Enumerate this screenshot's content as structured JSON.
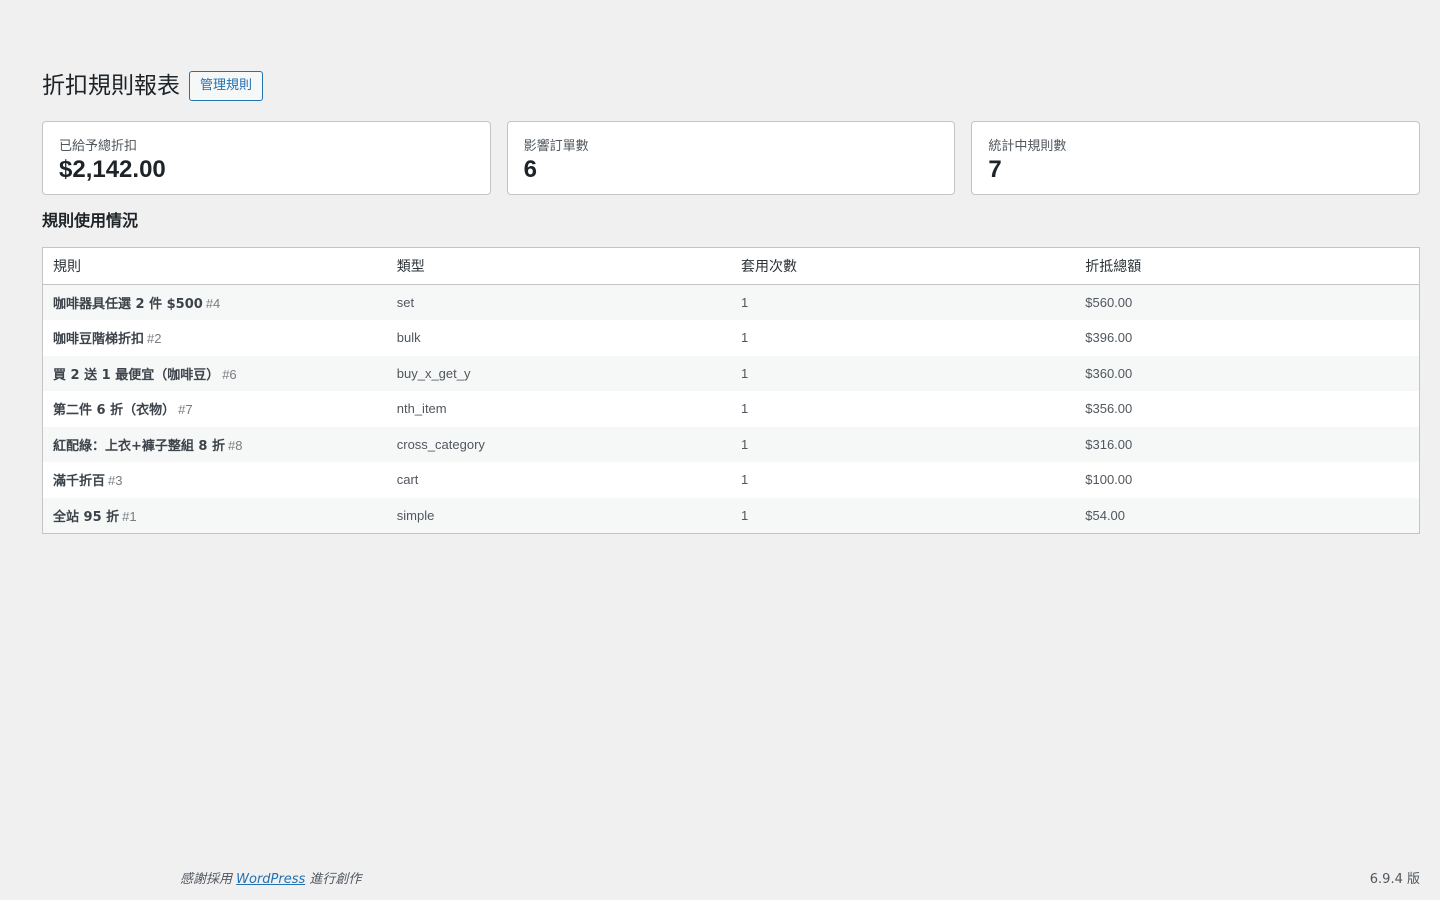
{
  "header": {
    "title": "折扣規則報表",
    "manage_button": "管理規則"
  },
  "stats": [
    {
      "label": "已給予總折扣",
      "value": "$2,142.00"
    },
    {
      "label": "影響訂單數",
      "value": "6"
    },
    {
      "label": "統計中規則數",
      "value": "7"
    }
  ],
  "section": {
    "title": "規則使用情況"
  },
  "table": {
    "columns": [
      "規則",
      "類型",
      "套用次數",
      "折抵總額"
    ],
    "rows": [
      {
        "name": "咖啡器具任選 2 件 $500",
        "id": "#4",
        "type": "set",
        "count": "1",
        "total": "$560.00"
      },
      {
        "name": "咖啡豆階梯折扣",
        "id": "#2",
        "type": "bulk",
        "count": "1",
        "total": "$396.00"
      },
      {
        "name": "買 2 送 1 最便宜（咖啡豆）",
        "id": "#6",
        "type": "buy_x_get_y",
        "count": "1",
        "total": "$360.00"
      },
      {
        "name": "第二件 6 折（衣物）",
        "id": "#7",
        "type": "nth_item",
        "count": "1",
        "total": "$356.00"
      },
      {
        "name": "紅配綠：上衣+褲子整組 8 折",
        "id": "#8",
        "type": "cross_category",
        "count": "1",
        "total": "$316.00"
      },
      {
        "name": "滿千折百",
        "id": "#3",
        "type": "cart",
        "count": "1",
        "total": "$100.00"
      },
      {
        "name": "全站 95 折",
        "id": "#1",
        "type": "simple",
        "count": "1",
        "total": "$54.00"
      }
    ]
  },
  "footer": {
    "thanks_prefix": "感謝採用 ",
    "thanks_link": "WordPress",
    "thanks_suffix": " 進行創作",
    "version": "6.9.4 版"
  },
  "colors": {
    "background": "#f0f0f1",
    "accent": "#2271b1",
    "border": "#c3c4c7"
  }
}
